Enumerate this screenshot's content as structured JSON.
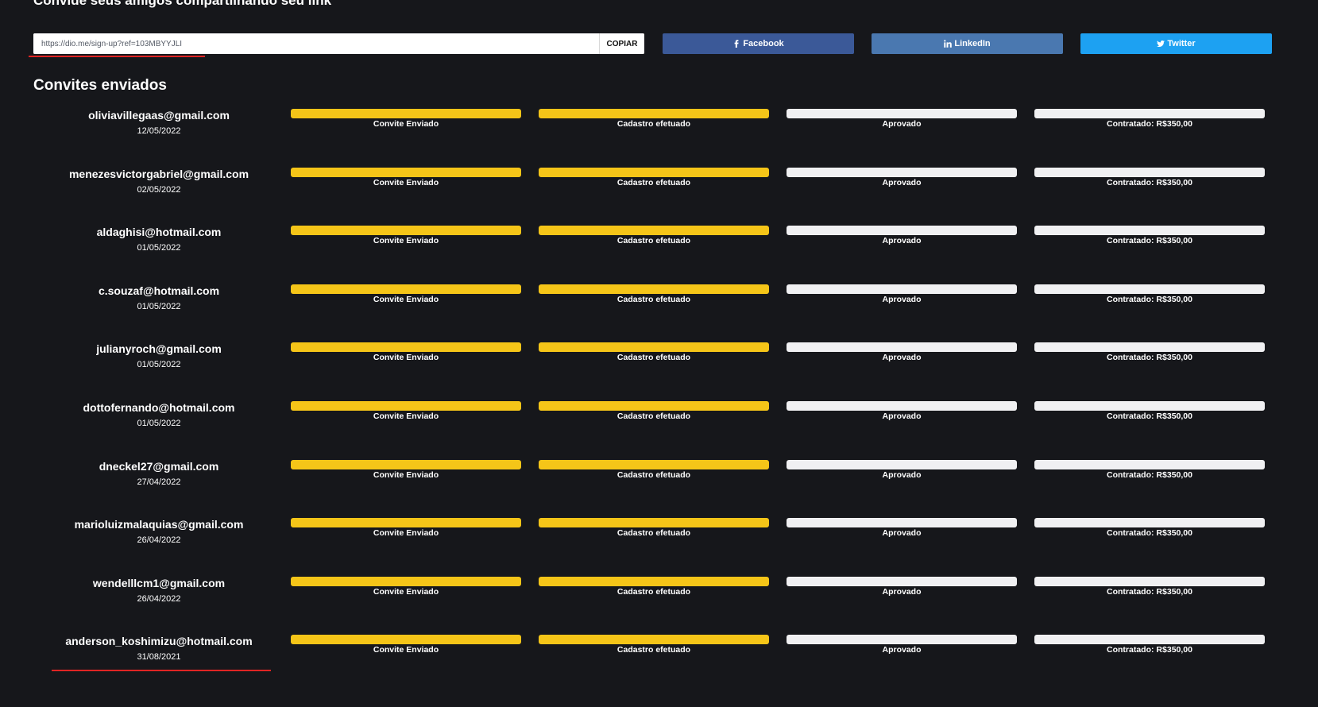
{
  "share": {
    "title": "Convide seus amigos compartilhando seu link",
    "link_value": "https://dio.me/sign-up?ref=103MBYYJLI",
    "copy_label": "COPIAR",
    "facebook_label": "Facebook",
    "linkedin_label": "LinkedIn",
    "twitter_label": "Twitter"
  },
  "colors": {
    "background": "#16171b",
    "progress_done": "#f5c518",
    "progress_pending": "#f0f0f2",
    "facebook": "#3b5998",
    "linkedin": "#4a78b0",
    "twitter": "#1da1f2",
    "highlight": "#e02424"
  },
  "invites": {
    "title": "Convites enviados",
    "stage_labels": [
      "Convite Enviado",
      "Cadastro efetuado",
      "Aprovado",
      "Contratado: R$350,00"
    ],
    "rows": [
      {
        "email": "oliviavillegaas@gmail.com",
        "date": "12/05/2022",
        "stages_completed": 2
      },
      {
        "email": "menezesvictorgabriel@gmail.com",
        "date": "02/05/2022",
        "stages_completed": 2
      },
      {
        "email": "aldaghisi@hotmail.com",
        "date": "01/05/2022",
        "stages_completed": 2
      },
      {
        "email": "c.souzaf@hotmail.com",
        "date": "01/05/2022",
        "stages_completed": 2
      },
      {
        "email": "julianyroch@gmail.com",
        "date": "01/05/2022",
        "stages_completed": 2
      },
      {
        "email": "dottofernando@hotmail.com",
        "date": "01/05/2022",
        "stages_completed": 2
      },
      {
        "email": "dneckel27@gmail.com",
        "date": "27/04/2022",
        "stages_completed": 2
      },
      {
        "email": "marioluizmalaquias@gmail.com",
        "date": "26/04/2022",
        "stages_completed": 2
      },
      {
        "email": "wendelllcm1@gmail.com",
        "date": "26/04/2022",
        "stages_completed": 2
      },
      {
        "email": "anderson_koshimizu@hotmail.com",
        "date": "31/08/2021",
        "stages_completed": 2
      }
    ]
  }
}
